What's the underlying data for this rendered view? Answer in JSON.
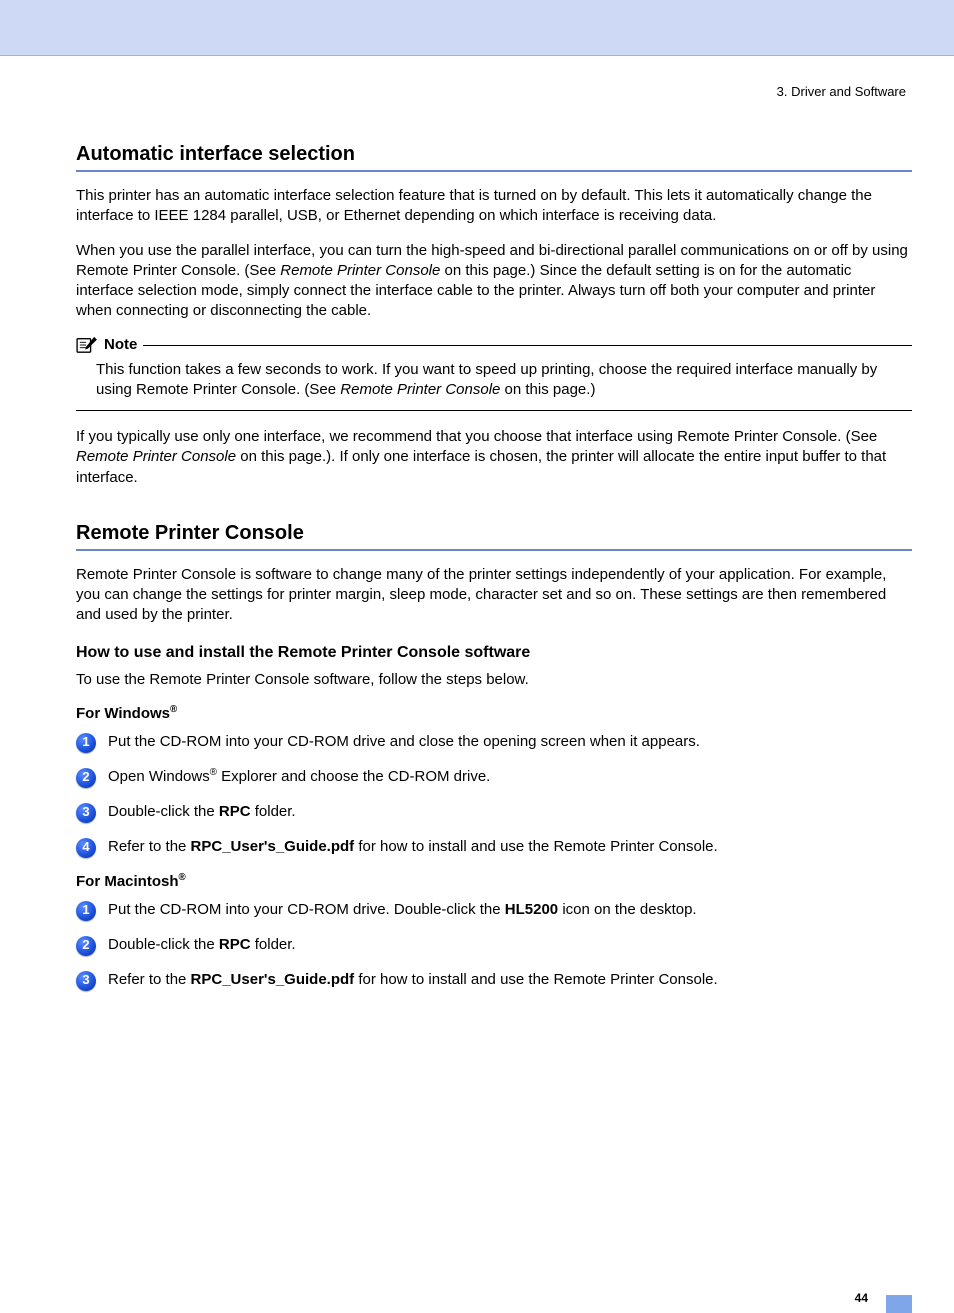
{
  "chapter": "3. Driver and Software",
  "section1": {
    "title": "Automatic interface selection",
    "para1": "This printer has an automatic interface selection feature that is turned on by default. This lets it automatically change the interface to IEEE 1284 parallel,  USB, or Ethernet depending on which interface is receiving data.",
    "para2a": "When you use the parallel interface, you can turn the high-speed and bi-directional parallel communications on or off by using Remote Printer Console. (See ",
    "para2_link": "Remote Printer Console",
    "para2b": " on this page.) Since the default setting is on for the automatic interface selection mode, simply connect the interface cable to the printer. Always turn off both your computer and printer when connecting or disconnecting the cable.",
    "note_label": "Note",
    "note_a": "This function takes a few seconds to work. If you want to speed up printing, choose the required interface manually by using Remote Printer Console. (See ",
    "note_link": "Remote Printer Console",
    "note_b": " on this page.)",
    "para3a": "If you typically use only one interface, we recommend that you choose that interface using Remote Printer Console. (See ",
    "para3_link": "Remote Printer Console",
    "para3b": " on this page.). If only one interface is chosen, the printer will allocate the entire input buffer to that interface."
  },
  "section2": {
    "title": "Remote Printer Console",
    "para1": "Remote Printer Console is software to change many of the printer settings independently of your application. For example, you can change the settings for printer margin, sleep mode, character set and so on. These settings are then remembered and used by the printer.",
    "sub_heading": "How to use and install the Remote Printer Console software",
    "sub_para": "To use the Remote Printer Console software, follow the steps below.",
    "windows_label": "For Windows",
    "win_steps": {
      "s1": "Put the CD-ROM into your CD-ROM drive and close the opening screen when it appears.",
      "s2a": "Open Windows",
      "s2b": " Explorer and choose the CD-ROM drive.",
      "s3a": "Double-click the ",
      "s3_bold": "RPC",
      "s3b": " folder.",
      "s4a": "Refer to the ",
      "s4_bold": "RPC_User's_Guide.pdf",
      "s4b": " for how to install and use the Remote Printer Console."
    },
    "mac_label": "For Macintosh",
    "mac_steps": {
      "s1a": "Put the CD-ROM into your CD-ROM drive. Double-click the ",
      "s1_bold": "HL5200",
      "s1b": " icon on the desktop.",
      "s2a": "Double-click the ",
      "s2_bold": "RPC",
      "s2b": " folder.",
      "s3a": "Refer to the ",
      "s3_bold": "RPC_User's_Guide.pdf",
      "s3b": " for how to install and use the Remote Printer Console."
    }
  },
  "page_number": "44"
}
